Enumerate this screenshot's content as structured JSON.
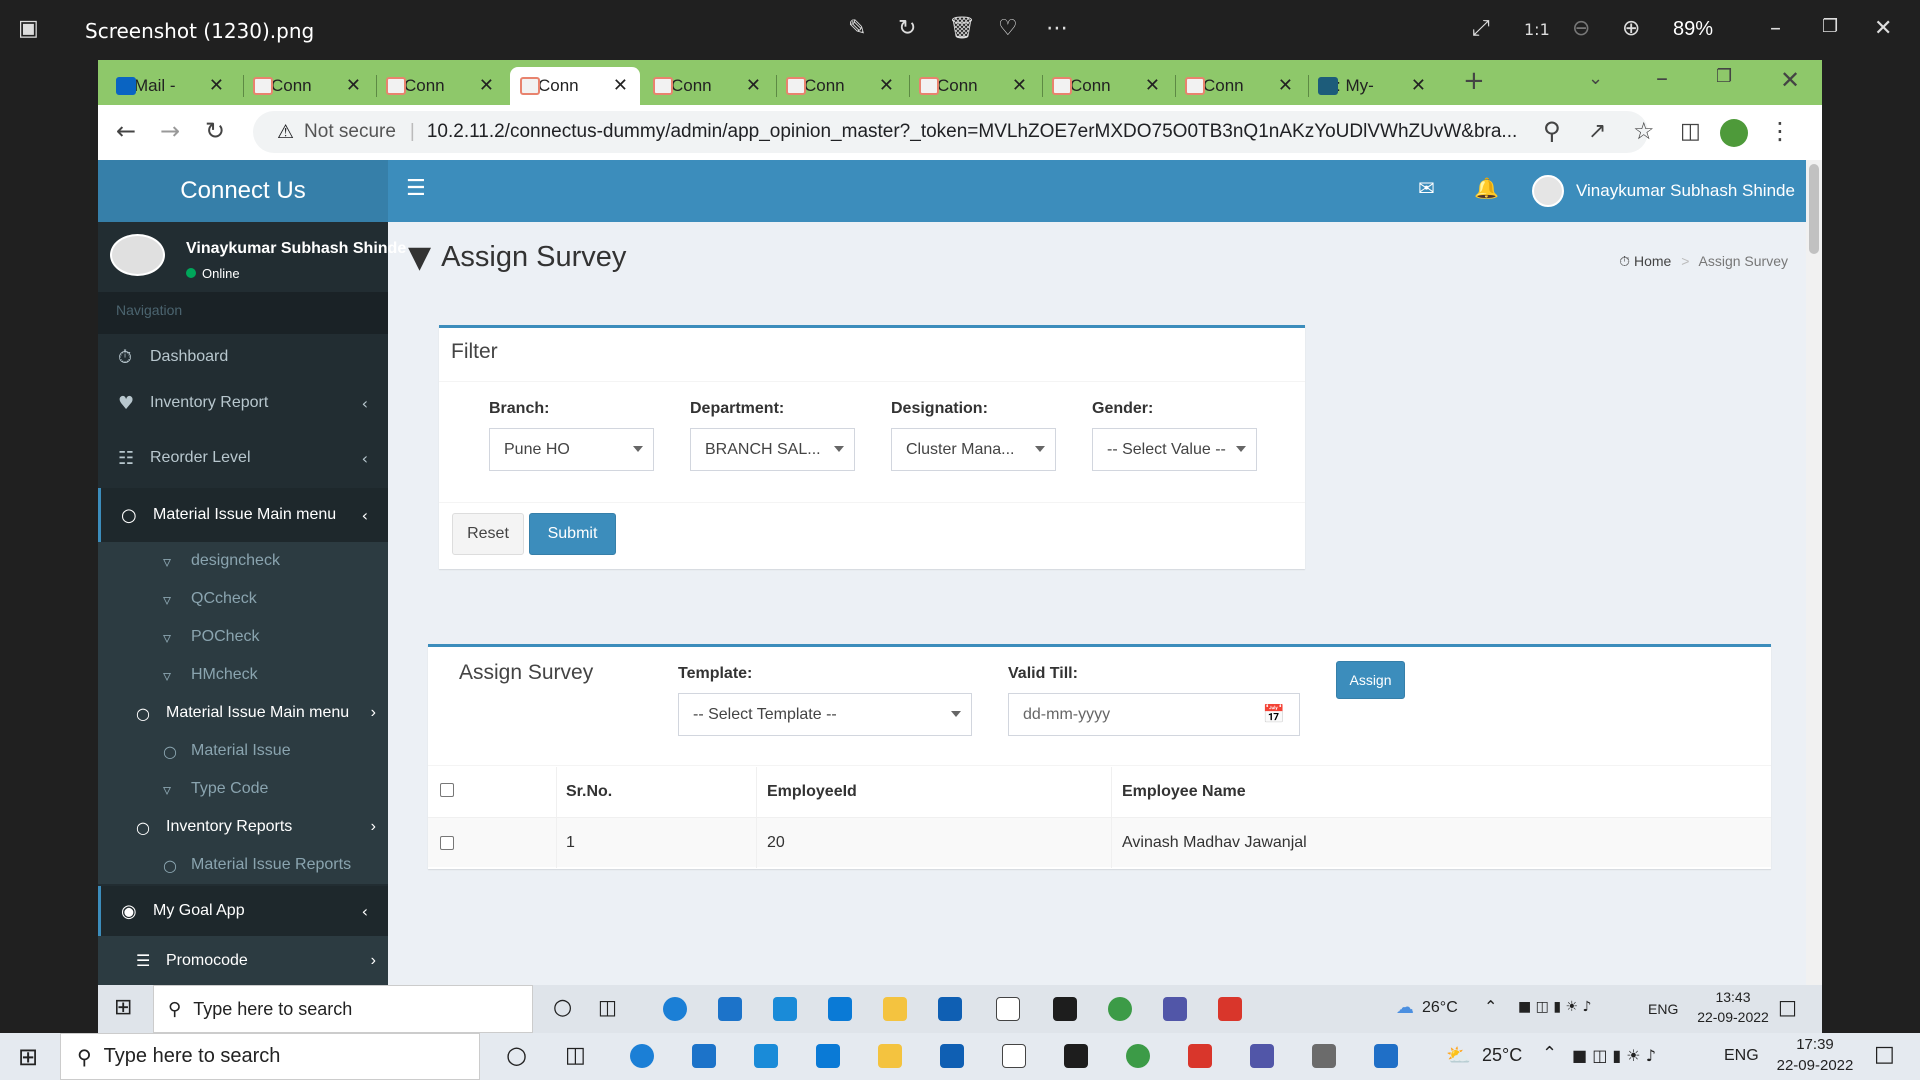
{
  "viewer": {
    "title": "Screenshot (1230).png",
    "zoom": "89%"
  },
  "browser": {
    "tabs": [
      {
        "label": "Mail -"
      },
      {
        "label": "Conn"
      },
      {
        "label": "Conn"
      },
      {
        "label": "Conn"
      },
      {
        "label": "Conn"
      },
      {
        "label": "Conn"
      },
      {
        "label": "Conn"
      },
      {
        "label": "Conn"
      },
      {
        "label": "Conn"
      },
      {
        "label": ": My-"
      }
    ],
    "security": "Not secure",
    "url": "10.2.11.2/connectus-dummy/admin/app_opinion_master?_token=MVLhZOE7erMXDO75O0TB3nQ1nAKzYoUDlVWhZUvW&bra..."
  },
  "app": {
    "brand": "Connect Us",
    "user_name": "Vinaykumar Subhash Shinde",
    "sidebar_user": "Vinaykumar Subhash Shinde",
    "status": "Online",
    "nav_header": "Navigation",
    "menu": {
      "dashboard": "Dashboard",
      "inventory_report": "Inventory Report",
      "reorder_level": "Reorder Level",
      "material_issue_main": "Material Issue Main menu",
      "designcheck": "designcheck",
      "qccheck": "QCcheck",
      "pocheck": "POCheck",
      "hmcheck": "HMcheck",
      "material_issue_main2": "Material Issue Main menu",
      "material_issue": "Material Issue",
      "type_code": "Type Code",
      "inventory_reports": "Inventory Reports",
      "material_issue_reports": "Material Issue Reports",
      "my_goal_app": "My Goal App",
      "promocode": "Promocode"
    }
  },
  "page": {
    "title": "Assign Survey",
    "breadcrumb_home": "Home",
    "breadcrumb_current": "Assign Survey"
  },
  "filter": {
    "title": "Filter",
    "branch_label": "Branch:",
    "branch_value": "Pune HO",
    "department_label": "Department:",
    "department_value": "BRANCH SAL...",
    "designation_label": "Designation:",
    "designation_value": "Cluster Mana...",
    "gender_label": "Gender:",
    "gender_value": "-- Select Value --",
    "reset": "Reset",
    "submit": "Submit"
  },
  "assign": {
    "title": "Assign Survey",
    "template_label": "Template:",
    "template_value": "-- Select Template --",
    "valid_label": "Valid Till:",
    "valid_placeholder": "dd-mm-yyyy",
    "assign_btn": "Assign",
    "columns": {
      "sr": "Sr.No.",
      "emp_id": "EmployeeId",
      "emp_name": "Employee Name"
    },
    "rows": [
      {
        "sr": "1",
        "emp_id": "20",
        "emp_name": "Avinash Madhav Jawanjal"
      }
    ]
  },
  "taskbar_inner": {
    "search": "Type here to search",
    "temp": "26°C",
    "lang": "ENG",
    "time": "13:43",
    "date": "22-09-2022"
  },
  "taskbar_outer": {
    "search": "Type here to search",
    "temp": "25°C",
    "lang": "ENG",
    "time": "17:39",
    "date": "22-09-2022"
  }
}
